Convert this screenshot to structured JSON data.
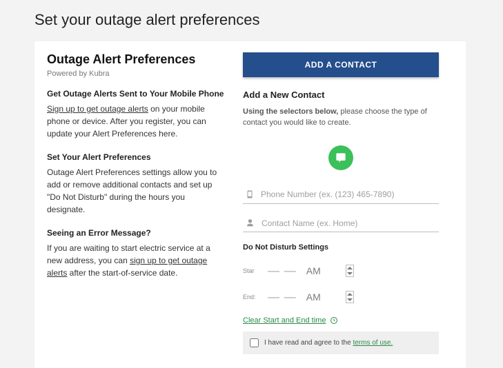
{
  "page": {
    "title": "Set your outage alert preferences"
  },
  "leftPane": {
    "heading": "Outage Alert Preferences",
    "poweredBy": "Powered by Kubra",
    "sections": [
      {
        "title": "Get Outage Alerts Sent to Your Mobile Phone",
        "linkText1": "Sign up to get outage alerts",
        "text1": " on your mobile phone or device. After you register, you can update your Alert Preferences here."
      },
      {
        "title": "Set Your Alert Preferences",
        "text": "Outage Alert Preferences settings allow you to add or remove additional contacts and set up \"Do Not Disturb\" during the hours you designate."
      },
      {
        "title": "Seeing an Error Message?",
        "text1": "If you are waiting to start electric service at a new address, you can ",
        "linkText": "sign up to get outage alerts",
        "text2": " after the start-of-service date."
      }
    ]
  },
  "rightPane": {
    "addButton": "ADD A CONTACT",
    "panelTitle": "Add a New Contact",
    "instructionBold": "Using the selectors below,",
    "instructionRest": " please choose the type of contact you would like to create.",
    "phonePlaceholder": "Phone Number (ex. (123) 465-7890)",
    "namePlaceholder": "Contact Name (ex. Home)",
    "dndHeading": "Do Not Disturb Settings",
    "startLabel": "Star",
    "endLabel": "End:",
    "timePlaceholder": "— —",
    "ampm": "AM",
    "clearLink": "Clear Start and End time",
    "agreeText": "I have read and agree to the ",
    "termsLink": "terms of use."
  }
}
